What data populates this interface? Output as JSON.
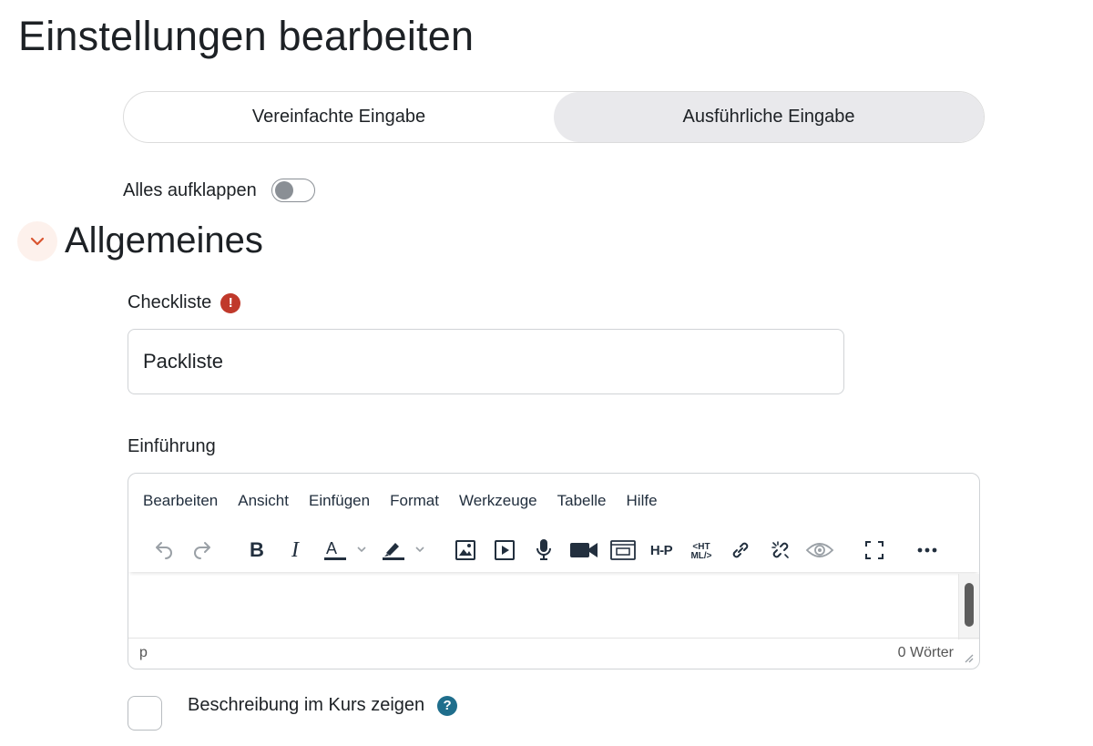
{
  "page": {
    "title": "Einstellungen bearbeiten"
  },
  "mode_switch": {
    "tabs": [
      {
        "label": "Vereinfachte Eingabe",
        "active": false
      },
      {
        "label": "Ausführliche Eingabe",
        "active": true
      }
    ]
  },
  "expand_all": {
    "label": "Alles aufklappen",
    "on": false
  },
  "section": {
    "title": "Allgemeines",
    "expanded": true,
    "icon": "chevron-down-icon",
    "accent_color": "#d9542f"
  },
  "checklist_field": {
    "label": "Checkliste",
    "value": "Packliste",
    "required_icon": "exclamation-icon",
    "required_color": "#c0392b"
  },
  "intro_field": {
    "label": "Einführung",
    "menu": [
      "Bearbeiten",
      "Ansicht",
      "Einfügen",
      "Format",
      "Werkzeuge",
      "Tabelle",
      "Hilfe"
    ],
    "toolbar_icons": [
      "undo-icon",
      "redo-icon",
      "bold-icon",
      "italic-icon",
      "text-color-icon",
      "highlight-color-icon",
      "image-icon",
      "media-icon",
      "record-audio-icon",
      "record-video-icon",
      "embed-icon",
      "h5p-icon",
      "html-source-icon",
      "link-icon",
      "unlink-icon",
      "accessibility-preview-icon",
      "fullscreen-icon",
      "more-icon"
    ],
    "h5p_text": "H-P",
    "html_text": "<HT ML/>",
    "status_path": "p",
    "word_count": "0 Wörter"
  },
  "show_description": {
    "label": "Beschreibung im Kurs zeigen",
    "checked": false,
    "help_color": "#1f6e8c"
  }
}
